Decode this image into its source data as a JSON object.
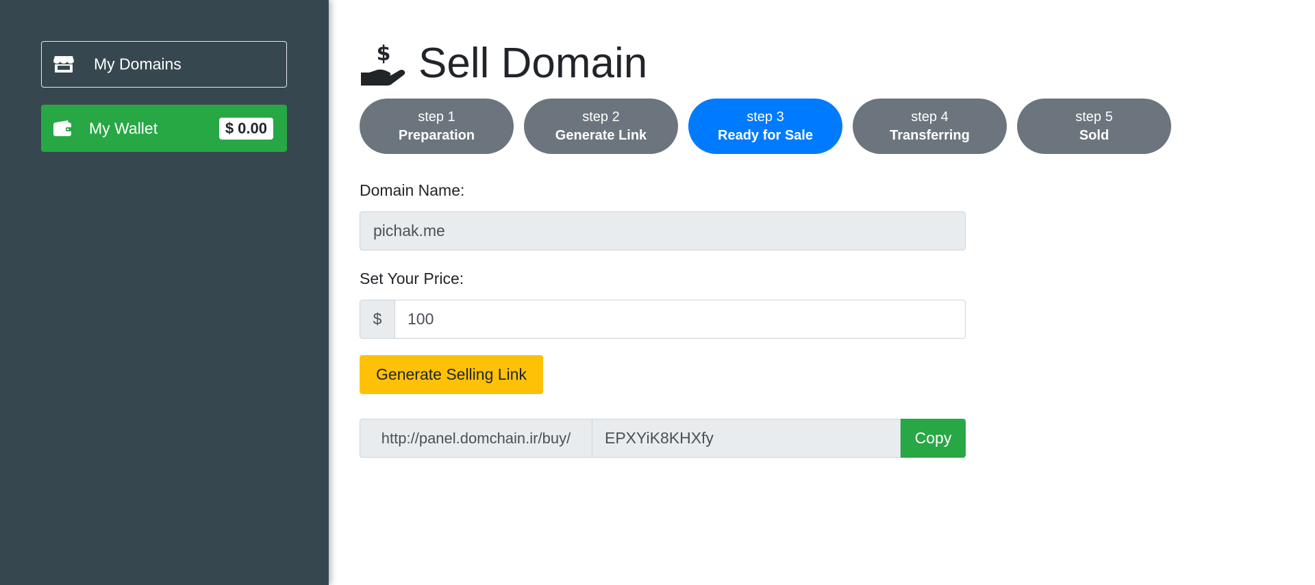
{
  "sidebar": {
    "my_domains": {
      "label": "My Domains",
      "icon": "store-icon"
    },
    "my_wallet": {
      "label": "My Wallet",
      "balance": "$ 0.00",
      "icon": "wallet-icon"
    }
  },
  "header": {
    "title": "Sell Domain",
    "icon": "hand-holding-dollar-icon"
  },
  "steps": [
    {
      "num": "step 1",
      "name": "Preparation",
      "active": false
    },
    {
      "num": "step 2",
      "name": "Generate Link",
      "active": false
    },
    {
      "num": "step 3",
      "name": "Ready for Sale",
      "active": true
    },
    {
      "num": "step 4",
      "name": "Transferring",
      "active": false
    },
    {
      "num": "step 5",
      "name": "Sold",
      "active": false
    }
  ],
  "form": {
    "domain_label": "Domain Name:",
    "domain_value": "pichak.me",
    "price_label": "Set Your Price:",
    "currency": "$",
    "price_value": "100",
    "generate_label": "Generate Selling Link",
    "link_prefix": "http://panel.domchain.ir/buy/",
    "link_code": "EPXYiK8KHXfy",
    "copy_label": "Copy"
  },
  "colors": {
    "sidebar": "#37474f",
    "wallet": "#28a745",
    "step_active": "#007bff",
    "step_inactive": "#6c757d",
    "generate": "#ffc107"
  }
}
